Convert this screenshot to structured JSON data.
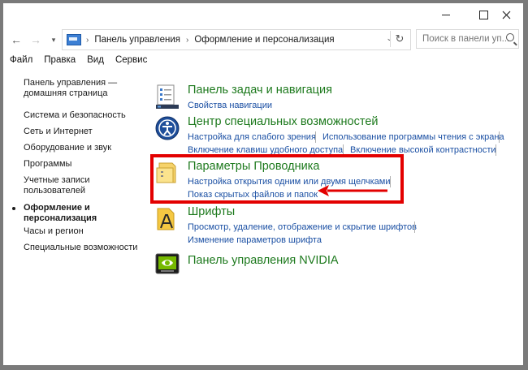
{
  "window": {
    "controls": {
      "minimize": "minimize-icon",
      "maximize": "maximize-icon",
      "close": "close-icon"
    }
  },
  "address": {
    "crumbs": [
      "Панель управления",
      "Оформление и персонализация"
    ],
    "search_placeholder": "Поиск в панели уп..."
  },
  "menu": [
    "Файл",
    "Правка",
    "Вид",
    "Сервис"
  ],
  "sidebar": {
    "items": [
      "Панель управления —\nдомашняя страница",
      "Система и безопасность",
      "Сеть и Интернет",
      "Оборудование и звук",
      "Программы",
      "Учетные записи\nпользователей",
      "Оформление и\nперсонализация",
      "Часы и регион",
      "Специальные возможности"
    ],
    "current_index": 6
  },
  "categories": [
    {
      "title": "Панель задач и навигация",
      "links": [
        "Свойства навигации"
      ],
      "icon": "taskbar-icon"
    },
    {
      "title": "Центр специальных возможностей",
      "links": [
        "Настройка для слабого зрения",
        "Использование программы чтения с экрана",
        "Включение клавиш удобного доступа",
        "Включение высокой контрастности"
      ],
      "icon": "ease-of-access-icon"
    },
    {
      "title": "Параметры Проводника",
      "links": [
        "Настройка открытия одним или двумя щелчками",
        "Показ скрытых файлов и папок"
      ],
      "icon": "folder-options-icon"
    },
    {
      "title": "Шрифты",
      "links": [
        "Просмотр, удаление, отображение и скрытие шрифтов",
        "Изменение параметров шрифта"
      ],
      "icon": "fonts-icon"
    },
    {
      "title": "Панель управления NVIDIA",
      "links": [],
      "icon": "nvidia-icon"
    }
  ],
  "colors": {
    "title_green": "#1e7a1e",
    "link_blue": "#1a4fa3",
    "highlight_red": "#e30000"
  }
}
